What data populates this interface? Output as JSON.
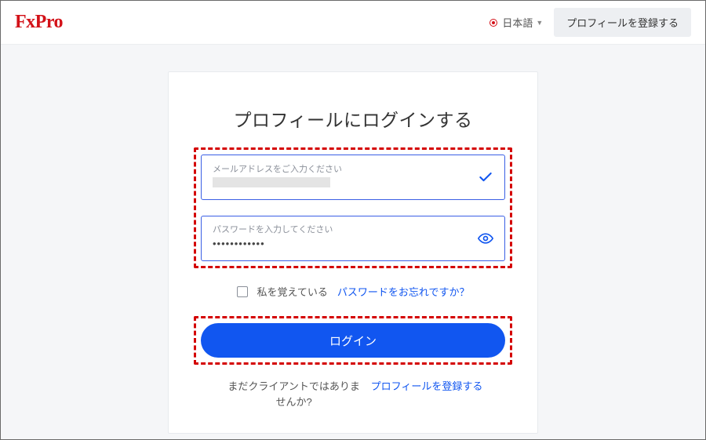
{
  "header": {
    "logo": "FxPro",
    "language": "日本語",
    "register_button": "プロフィールを登録する"
  },
  "login": {
    "title": "プロフィールにログインする",
    "email_label": "メールアドレスをご入力ください",
    "email_value": "",
    "password_label": "パスワードを入力してください",
    "password_value": "••••••••••••",
    "remember_label": "私を覚えている",
    "forgot_label": "パスワードをお忘れですか？",
    "login_button": "ログイン",
    "not_client_text": "まだクライアントではありませんか?",
    "register_link": "プロフィールを登録する"
  },
  "colors": {
    "brand_red": "#d31118",
    "primary_blue": "#1156f0",
    "highlight_dash": "#d40000"
  }
}
